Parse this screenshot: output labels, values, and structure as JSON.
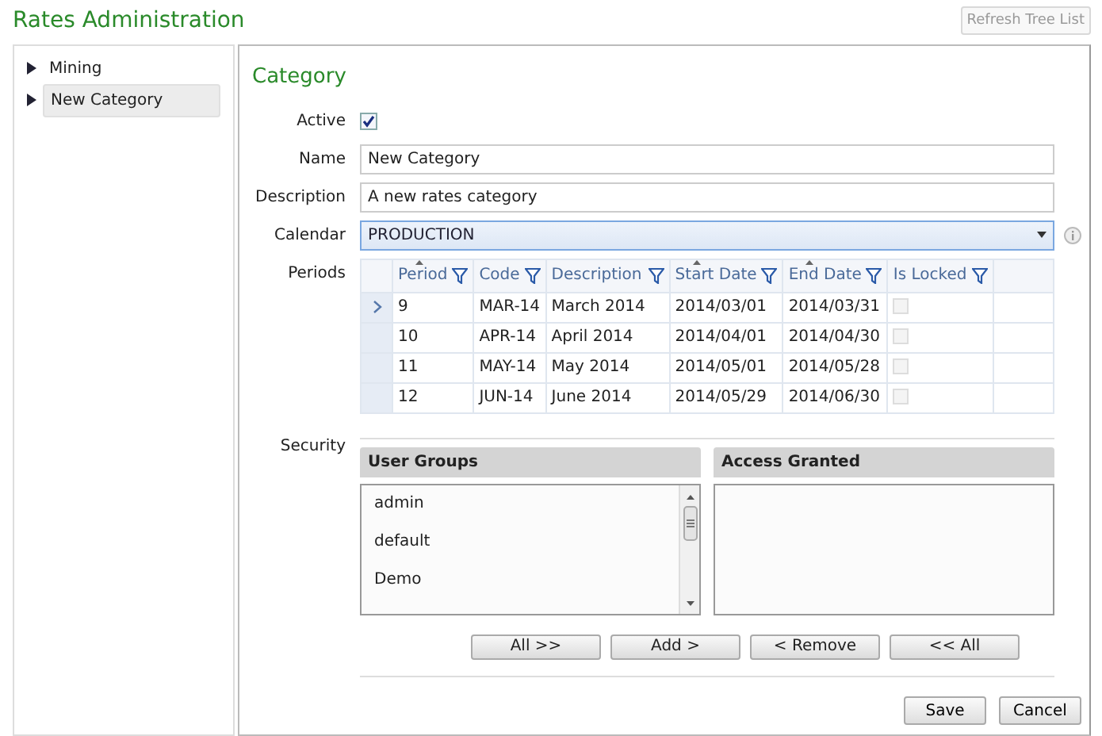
{
  "window": {
    "title": "Rates Administration"
  },
  "refresh_button": {
    "label": "Refresh Tree List",
    "disabled": true
  },
  "tree": {
    "items": [
      {
        "label": "Mining",
        "selected": false,
        "expandable": true
      },
      {
        "label": "New Category",
        "selected": true,
        "expandable": true
      }
    ]
  },
  "form": {
    "title": "Category",
    "active": {
      "label": "Active",
      "checked": true
    },
    "name": {
      "label": "Name",
      "value": "New Category"
    },
    "description": {
      "label": "Description",
      "value": "A new rates category"
    },
    "calendar": {
      "label": "Calendar",
      "value": "PRODUCTION"
    },
    "periods": {
      "label": "Periods",
      "columns": [
        {
          "label": "Period",
          "sorted": true
        },
        {
          "label": "Code",
          "sorted": false
        },
        {
          "label": "Description",
          "sorted": false
        },
        {
          "label": "Start Date",
          "sorted": true
        },
        {
          "label": "End Date",
          "sorted": true
        },
        {
          "label": "Is Locked",
          "sorted": false
        }
      ],
      "rows": [
        {
          "current": true,
          "cells": [
            "9",
            "MAR-14",
            "March 2014",
            "2014/03/01",
            "2014/03/31"
          ],
          "locked": false
        },
        {
          "current": false,
          "cells": [
            "10",
            "APR-14",
            "April 2014",
            "2014/04/01",
            "2014/04/30"
          ],
          "locked": false
        },
        {
          "current": false,
          "cells": [
            "11",
            "MAY-14",
            "May 2014",
            "2014/05/01",
            "2014/05/28"
          ],
          "locked": false
        },
        {
          "current": false,
          "cells": [
            "12",
            "JUN-14",
            "June 2014",
            "2014/05/29",
            "2014/06/30"
          ],
          "locked": false
        }
      ]
    },
    "security": {
      "label": "Security",
      "user_groups": {
        "title": "User Groups",
        "items": [
          "admin",
          "default",
          "Demo"
        ]
      },
      "access_granted": {
        "title": "Access Granted"
      },
      "buttons": [
        "All >>",
        "Add >",
        "< Remove",
        "<< All"
      ]
    },
    "actions": [
      "Save",
      "Cancel"
    ]
  }
}
